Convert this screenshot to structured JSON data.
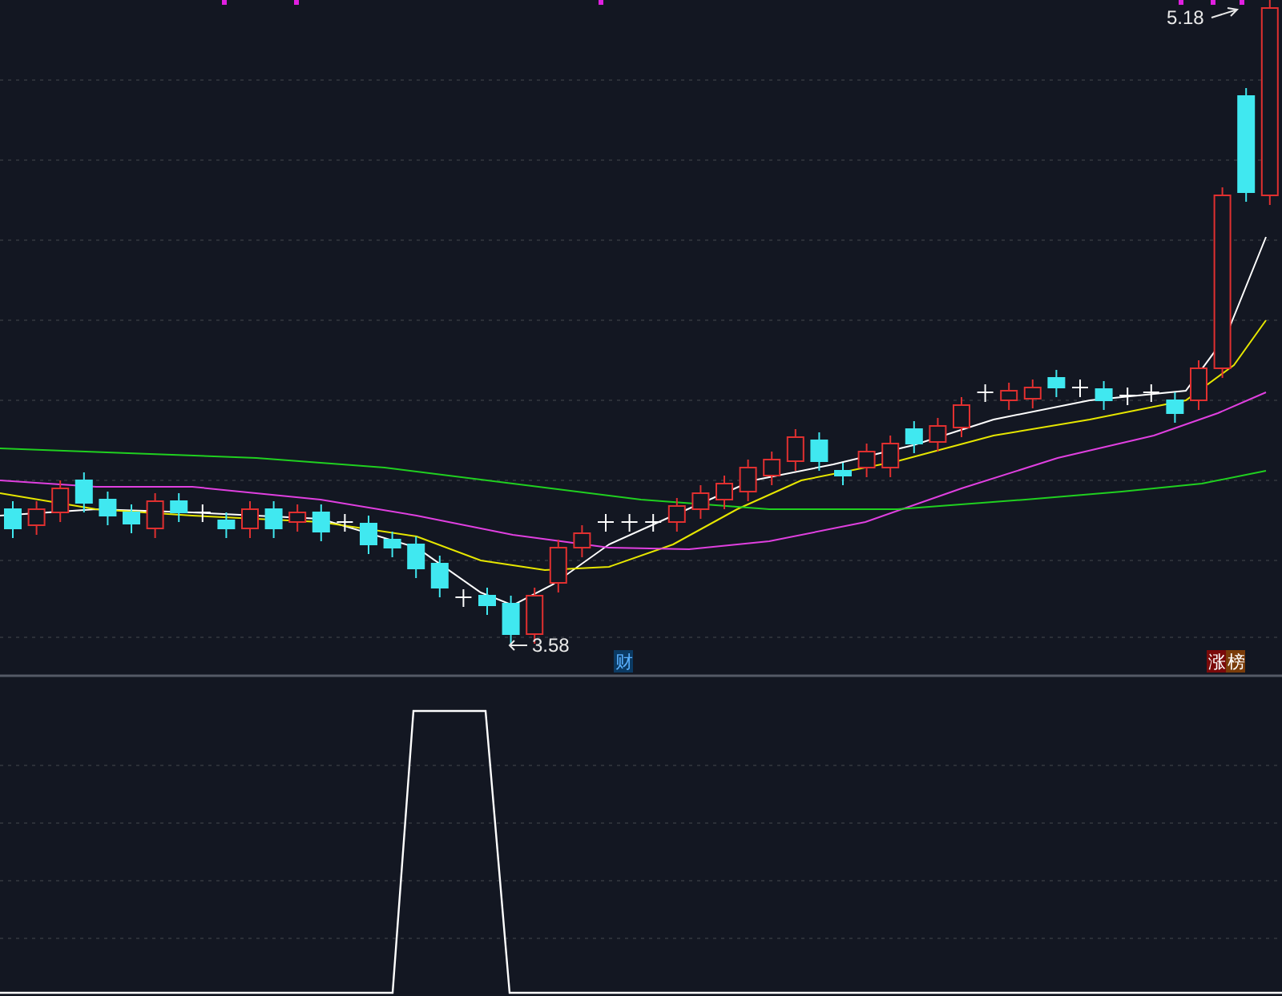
{
  "price_chart": {
    "high_label": "5.18",
    "low_label": "3.58",
    "markers": [
      {
        "text": "财",
        "color": "#0b3a63"
      },
      {
        "text": "涨",
        "color": "#7a0a0a"
      },
      {
        "text": "榜",
        "color": "#7a3c0a"
      }
    ]
  }
}
